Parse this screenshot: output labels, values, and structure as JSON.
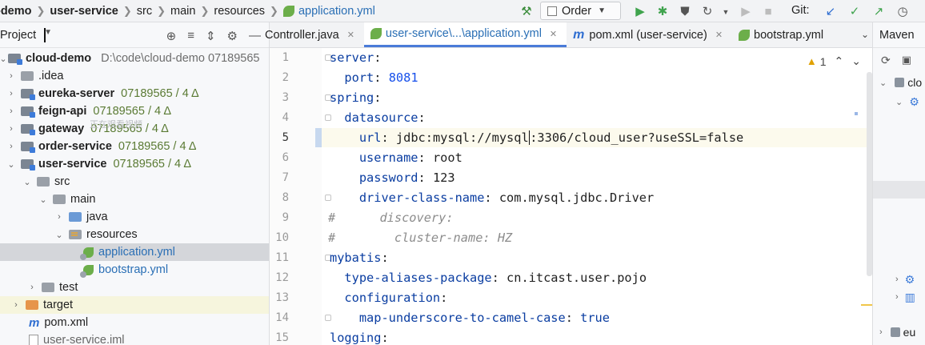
{
  "navbar": {
    "crumbs": [
      "-demo",
      "user-service",
      "src",
      "main",
      "resources",
      "application.yml"
    ],
    "run_config": "Order",
    "git_label": "Git:"
  },
  "project": {
    "title": "Project",
    "tree": [
      {
        "label": "cloud-demo",
        "detail": "D:\\code\\cloud-demo 07189565"
      },
      {
        "label": ".idea"
      },
      {
        "label": "eureka-server",
        "git": "07189565 / 4 Δ"
      },
      {
        "label": "feign-api",
        "git": "07189565 / 4 Δ"
      },
      {
        "label": "gateway",
        "git": "07189565 / 4 Δ"
      },
      {
        "label": "order-service",
        "git": "07189565 / 4 Δ"
      },
      {
        "label": "user-service",
        "git": "07189565 / 4 Δ"
      },
      {
        "label": "src"
      },
      {
        "label": "main"
      },
      {
        "label": "java"
      },
      {
        "label": "resources"
      },
      {
        "label": "application.yml"
      },
      {
        "label": "bootstrap.yml"
      },
      {
        "label": "test"
      },
      {
        "label": "target"
      },
      {
        "label": "pom.xml"
      },
      {
        "label": "user-service.iml"
      }
    ],
    "watermark": "正在观看视频"
  },
  "tabs": [
    {
      "label": "Controller.java"
    },
    {
      "label": "user-service\\...\\application.yml"
    },
    {
      "label": "pom.xml (user-service)"
    },
    {
      "label": "bootstrap.yml"
    }
  ],
  "editor": {
    "warnings": "1",
    "line_numbers": [
      "1",
      "2",
      "3",
      "4",
      "5",
      "6",
      "7",
      "8",
      "9",
      "10",
      "11",
      "12",
      "13",
      "14",
      "15"
    ],
    "current_line": 5,
    "code": [
      {
        "key": "server",
        "sep": ":",
        "val": "",
        "indent": ""
      },
      {
        "key": "port",
        "sep": ": ",
        "val": "8081",
        "indent": "  ",
        "type": "num"
      },
      {
        "key": "spring",
        "sep": ":",
        "val": "",
        "indent": ""
      },
      {
        "key": "datasource",
        "sep": ":",
        "val": "",
        "indent": "  "
      },
      {
        "key": "url",
        "sep": ": ",
        "val_a": "jdbc:mysql://mysql",
        "val_b": ":3306/cloud_user?useSSL=false",
        "indent": "    "
      },
      {
        "key": "username",
        "sep": ": ",
        "val": "root",
        "indent": "    "
      },
      {
        "key": "password",
        "sep": ": ",
        "val": "123",
        "indent": "    "
      },
      {
        "key": "driver-class-name",
        "sep": ": ",
        "val": "com.mysql.jdbc.Driver",
        "indent": "    "
      },
      {
        "comment": "#      discovery:"
      },
      {
        "comment": "#        cluster-name: HZ"
      },
      {
        "key": "mybatis",
        "sep": ":",
        "val": "",
        "indent": ""
      },
      {
        "key": "type-aliases-package",
        "sep": ": ",
        "val": "cn.itcast.user.pojo",
        "indent": "  "
      },
      {
        "key": "configuration",
        "sep": ":",
        "val": "",
        "indent": "  "
      },
      {
        "key": "map-underscore-to-camel-case",
        "sep": ": ",
        "val": "true",
        "indent": "    ",
        "type": "bool"
      },
      {
        "key": "logging",
        "sep": ":",
        "val": "",
        "indent": ""
      }
    ]
  },
  "maven": {
    "title": "Maven",
    "items": [
      "clo",
      "eu"
    ]
  }
}
